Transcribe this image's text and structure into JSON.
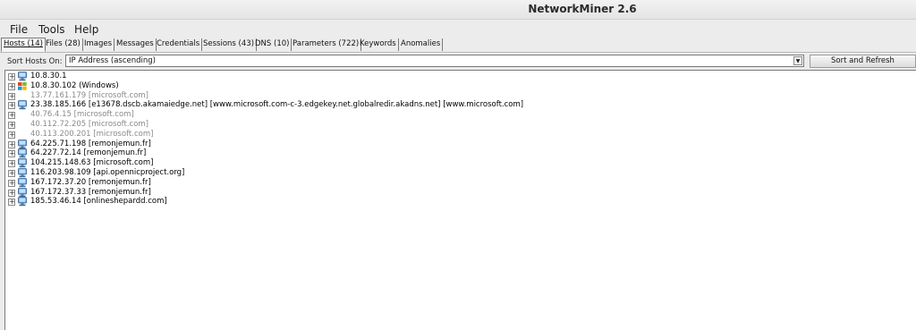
{
  "window": {
    "title": "NetworkMiner 2.6"
  },
  "menu": [
    "File",
    "Tools",
    "Help"
  ],
  "tabs": [
    "Hosts (14)",
    "Files (28)",
    "Images",
    "Messages",
    "Credentials",
    "Sessions (43)",
    "DNS (10)",
    "Parameters (722)",
    "Keywords",
    "Anomalies"
  ],
  "sort": {
    "label": "Sort Hosts On:",
    "selected": "IP Address (ascending)",
    "button": "Sort and Refresh"
  },
  "hosts": [
    {
      "text": "10.8.30.1",
      "icon": "network-host-icon",
      "dim": false
    },
    {
      "text": "10.8.30.102 (Windows)",
      "icon": "windows-host-icon",
      "dim": false
    },
    {
      "text": "13.77.161.179 [microsoft.com]",
      "icon": "none",
      "dim": true
    },
    {
      "text": "23.38.185.166 [e13678.dscb.akamaiedge.net] [www.microsoft.com-c-3.edgekey.net.globalredir.akadns.net] [www.microsoft.com]",
      "icon": "network-host-icon",
      "dim": false
    },
    {
      "text": "40.76.4.15 [microsoft.com]",
      "icon": "none",
      "dim": true
    },
    {
      "text": "40.112.72.205 [microsoft.com]",
      "icon": "none",
      "dim": true
    },
    {
      "text": "40.113.200.201 [microsoft.com]",
      "icon": "none",
      "dim": true
    },
    {
      "text": "64.225.71.198 [remonjemun.fr]",
      "icon": "network-host-icon",
      "dim": false
    },
    {
      "text": "64.227.72.14 [remonjemun.fr]",
      "icon": "network-host-icon",
      "dim": false
    },
    {
      "text": "104.215.148.63 [microsoft.com]",
      "icon": "network-host-icon",
      "dim": false
    },
    {
      "text": "116.203.98.109 [api.opennicproject.org]",
      "icon": "network-host-icon",
      "dim": false
    },
    {
      "text": "167.172.37.20 [remonjemun.fr]",
      "icon": "network-host-icon",
      "dim": false
    },
    {
      "text": "167.172.37.33 [remonjemun.fr]",
      "icon": "network-host-icon",
      "dim": false
    },
    {
      "text": "185.53.46.14 [onlineshepardd.com]",
      "icon": "network-host-icon",
      "dim": false
    }
  ]
}
